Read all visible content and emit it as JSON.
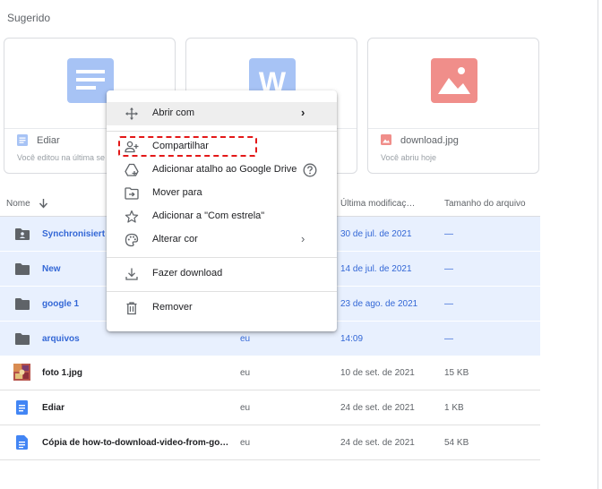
{
  "suggested": {
    "title": "Sugerido",
    "cards": [
      {
        "name": "Ediar",
        "meta": "Você editou na última se",
        "icon": "docs-icon"
      },
      {
        "name": "",
        "meta": "",
        "icon": "word-icon"
      },
      {
        "name": "download.jpg",
        "meta": "Você abriu hoje",
        "icon": "image-icon"
      }
    ]
  },
  "table": {
    "headers": {
      "name": "Nome",
      "modified": "Última modificaç…",
      "size": "Tamanho do arquivo"
    },
    "rows": [
      {
        "name": "Synchronisiert",
        "owner": "",
        "date": "30 de jul. de 2021",
        "size": "—",
        "icon": "shared-folder-icon",
        "selected": true
      },
      {
        "name": "New",
        "owner": "",
        "date": "14 de jul. de 2021",
        "size": "—",
        "icon": "folder-icon",
        "selected": true
      },
      {
        "name": "google 1",
        "owner": "",
        "date": "23 de ago. de 2021",
        "size": "—",
        "icon": "folder-icon",
        "selected": true
      },
      {
        "name": "arquivos",
        "owner": "eu",
        "date": "14:09",
        "size": "—",
        "icon": "folder-icon",
        "selected": true
      },
      {
        "name": "foto 1.jpg",
        "owner": "eu",
        "date": "10 de set. de 2021",
        "size": "15 KB",
        "icon": "photo-thumbnail",
        "selected": false
      },
      {
        "name": "Ediar",
        "owner": "eu",
        "date": "24 de set. de 2021",
        "size": "1 KB",
        "icon": "docs-icon",
        "selected": false
      },
      {
        "name": "Cópia de how-to-download-video-from-go…",
        "owner": "eu",
        "date": "24 de set. de 2021",
        "size": "54 KB",
        "icon": "docs-icon",
        "selected": false
      }
    ]
  },
  "context_menu": {
    "items": [
      {
        "label": "Abrir com",
        "icon": "move-arrows-icon",
        "submenu": true
      },
      {
        "label": "Compartilhar",
        "icon": "person-add-icon"
      },
      {
        "label": "Adicionar atalho ao Google Drive",
        "icon": "drive-shortcut-icon",
        "help": true
      },
      {
        "label": "Mover para",
        "icon": "move-folder-icon"
      },
      {
        "label": "Adicionar a \"Com estrela\"",
        "icon": "star-icon"
      },
      {
        "label": "Alterar cor",
        "icon": "palette-icon",
        "submenu": true
      },
      {
        "label": "Fazer download",
        "icon": "download-icon"
      },
      {
        "label": "Remover",
        "icon": "trash-icon"
      }
    ]
  },
  "colors": {
    "selected_row": "#e8f0fe",
    "accent": "#3367d6",
    "highlight": "#e31818"
  }
}
